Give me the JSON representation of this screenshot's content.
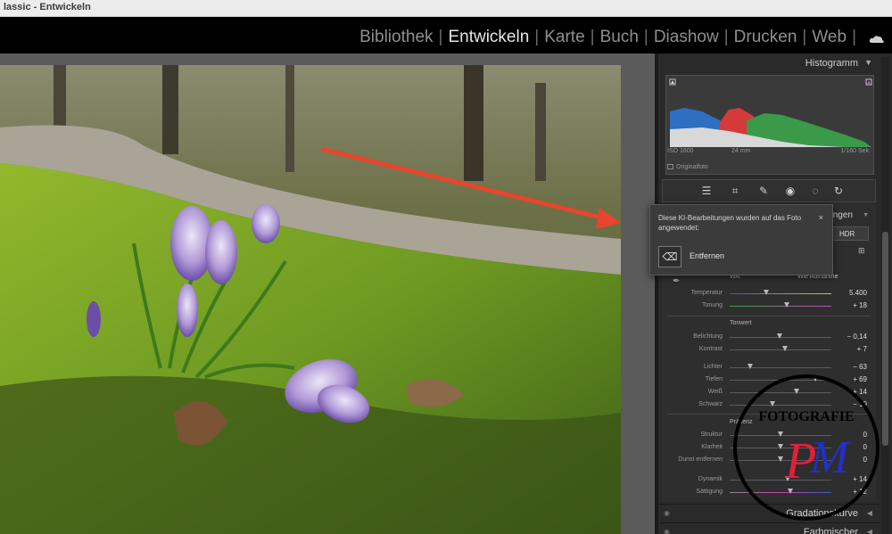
{
  "window": {
    "title": "lassic - Entwickeln"
  },
  "modules": [
    {
      "label": "Bibliothek",
      "active": false
    },
    {
      "label": "Entwickeln",
      "active": true
    },
    {
      "label": "Karte",
      "active": false
    },
    {
      "label": "Buch",
      "active": false
    },
    {
      "label": "Diashow",
      "active": false
    },
    {
      "label": "Drucken",
      "active": false
    },
    {
      "label": "Web",
      "active": false
    }
  ],
  "module_separator": "|",
  "histogram": {
    "title": "Histogramm",
    "iso": "ISO 1600",
    "focal": "24 mm",
    "shutter": "1/160 Sek.",
    "original_photo": "Originalfoto"
  },
  "tools": [
    "edit-icon",
    "crop-icon",
    "heal-icon",
    "redeye-icon",
    "mask-icon",
    "reset-icon"
  ],
  "basic": {
    "panel_label": "ungen",
    "hdr": "HDR",
    "wb_label": "WA:",
    "wb_value": "Wie Aufnahme",
    "tone_label": "Tonwert",
    "presence_label": "Präsenz"
  },
  "sliders": {
    "temperature": {
      "label": "Temperatur",
      "value": "5.400",
      "pos": 0.36
    },
    "tint": {
      "label": "Tonung",
      "value": "+ 18",
      "pos": 0.56
    },
    "exposure": {
      "label": "Belichtung",
      "value": "− 0,14",
      "pos": 0.49
    },
    "contrast": {
      "label": "Kontrast",
      "value": "+ 7",
      "pos": 0.54
    },
    "highlights": {
      "label": "Lichter",
      "value": "− 63",
      "pos": 0.2
    },
    "shadows": {
      "label": "Tiefen",
      "value": "+ 69",
      "pos": 0.84
    },
    "whites": {
      "label": "Weiß",
      "value": "+ 14",
      "pos": 0.66
    },
    "blacks": {
      "label": "Schwarz",
      "value": "− 19",
      "pos": 0.42
    },
    "texture": {
      "label": "Struktur",
      "value": "0",
      "pos": 0.5
    },
    "clarity": {
      "label": "Klarheit",
      "value": "0",
      "pos": 0.5
    },
    "dehaze": {
      "label": "Dunst entfernen",
      "value": "0",
      "pos": 0.5
    },
    "vibrance": {
      "label": "Dynamik",
      "value": "+ 14",
      "pos": 0.57
    },
    "saturation": {
      "label": "Sättigung",
      "value": "+ 12",
      "pos": 0.6
    }
  },
  "collapsed_panels": [
    "Gradationskurve",
    "Farbmischer"
  ],
  "popup": {
    "message": "Diese KI-Bearbeitungen wurden auf das Foto angewendet:",
    "close": "×",
    "item_label": "Entfernen"
  },
  "watermark": {
    "text_top": "FOTOGRAFIE",
    "logo_letters": "PM"
  },
  "colors": {
    "module_active": "#e6e6e6",
    "module_inactive": "#8f8f8f",
    "arrow": "#e8452c",
    "watermark_red": "#e0203a",
    "watermark_blue": "#2030c8"
  }
}
